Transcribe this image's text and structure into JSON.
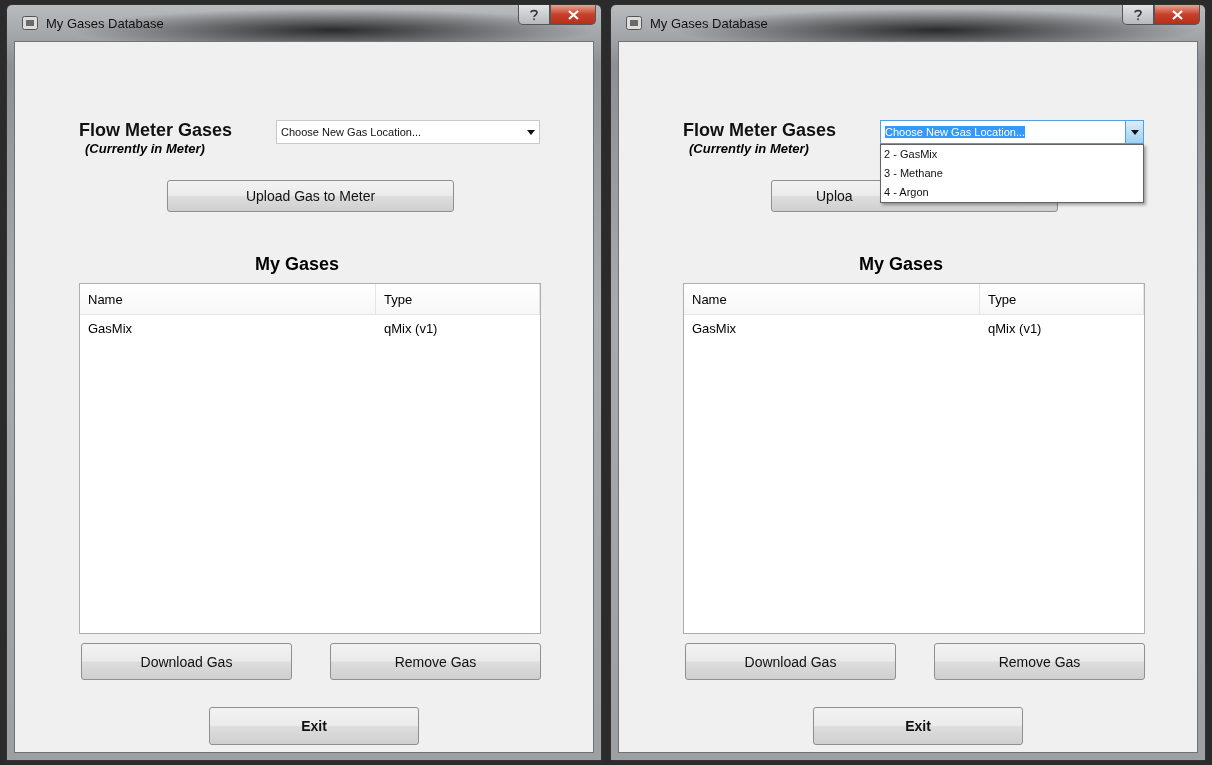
{
  "windows": [
    {
      "title": "My Gases Database",
      "heading": "Flow Meter Gases",
      "subheading": "(Currently in Meter)",
      "dropdown": {
        "value": "Choose New Gas Location...",
        "expanded": false
      },
      "upload_button": "Upload Gas to Meter",
      "list_title": "My Gases",
      "list": {
        "columns": [
          "Name",
          "Type"
        ],
        "rows": [
          [
            "GasMix",
            "qMix (v1)"
          ]
        ]
      },
      "buttons": [
        "Download Gas",
        "Remove Gas"
      ],
      "exit_button": "Exit"
    },
    {
      "title": "My Gases Database",
      "heading": "Flow Meter Gases",
      "subheading": "(Currently in Meter)",
      "dropdown": {
        "value": "Choose New Gas Location...",
        "expanded": true,
        "options": [
          "2 - GasMix",
          "3 - Methane",
          "4 - Argon"
        ]
      },
      "upload_button": "Uploa",
      "list_title": "My Gases",
      "list": {
        "columns": [
          "Name",
          "Type"
        ],
        "rows": [
          [
            "GasMix",
            "qMix (v1)"
          ]
        ]
      },
      "buttons": [
        "Download Gas",
        "Remove Gas"
      ],
      "exit_button": "Exit"
    }
  ]
}
